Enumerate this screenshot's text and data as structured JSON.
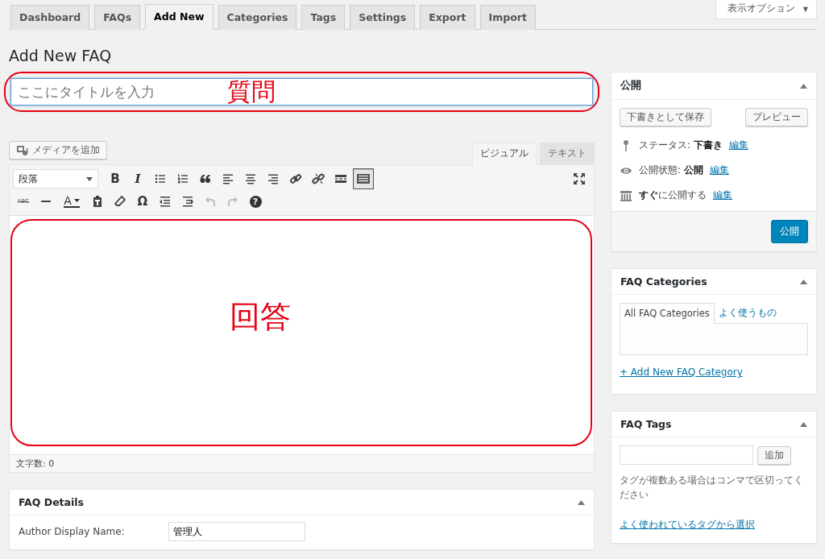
{
  "tabs": [
    {
      "label": "Dashboard",
      "selected": false
    },
    {
      "label": "FAQs",
      "selected": false
    },
    {
      "label": "Add New",
      "selected": true
    },
    {
      "label": "Categories",
      "selected": false
    },
    {
      "label": "Tags",
      "selected": false
    },
    {
      "label": "Settings",
      "selected": false
    },
    {
      "label": "Export",
      "selected": false
    },
    {
      "label": "Import",
      "selected": false
    }
  ],
  "screen_options": {
    "label": "表示オプション",
    "caret": "▼"
  },
  "heading": "Add New FAQ",
  "title_field": {
    "placeholder": "ここにタイトルを入力"
  },
  "annotations": [
    {
      "text": "質問"
    },
    {
      "text": "回答"
    }
  ],
  "editor": {
    "media_button": "メディアを追加",
    "mode_tabs": [
      {
        "label": "ビジュアル",
        "selected": true
      },
      {
        "label": "テキスト",
        "selected": false
      }
    ],
    "format_select": "段落",
    "toolbar_rows": [
      [
        {
          "kind": "bold",
          "glyph": "B"
        },
        {
          "kind": "italic",
          "glyph": "I"
        },
        {
          "kind": "bullets"
        },
        {
          "kind": "numbers"
        },
        {
          "kind": "quote"
        },
        {
          "kind": "align-left"
        },
        {
          "kind": "align-center"
        },
        {
          "kind": "align-right"
        },
        {
          "kind": "link"
        },
        {
          "kind": "unlink"
        },
        {
          "kind": "more"
        },
        {
          "kind": "kitchen-sink",
          "pressed": true
        }
      ],
      [
        {
          "kind": "strike",
          "glyph": "ABC"
        },
        {
          "kind": "hr"
        },
        {
          "kind": "color",
          "glyph": "A"
        },
        {
          "kind": "paste"
        },
        {
          "kind": "eraser"
        },
        {
          "kind": "symbol",
          "glyph": "Ω"
        },
        {
          "kind": "outdent"
        },
        {
          "kind": "indent"
        },
        {
          "kind": "undo",
          "disabled": true
        },
        {
          "kind": "redo",
          "disabled": true
        },
        {
          "kind": "help",
          "glyph": "?"
        }
      ]
    ],
    "word_count": "文字数: 0"
  },
  "details": {
    "title": "FAQ Details",
    "fields": [
      {
        "label": "Author Display Name:",
        "value": "管理人"
      }
    ]
  },
  "publish": {
    "title": "公開",
    "save_draft": "下書きとして保存",
    "preview": "プレビュー",
    "rows": [
      {
        "kind": "status",
        "label": "ステータス:",
        "value": "下書き",
        "link": "編集"
      },
      {
        "kind": "visibility",
        "label": "公開状態:",
        "value": "公開",
        "link": "編集"
      },
      {
        "kind": "schedule",
        "label": "に公開する",
        "value": "すぐ",
        "link": "編集"
      }
    ],
    "publish_button": "公開"
  },
  "categories": {
    "title": "FAQ Categories",
    "tabs": [
      {
        "label": "All FAQ Categories",
        "selected": true
      },
      {
        "label": "よく使うもの",
        "selected": false
      }
    ],
    "add_link": "+ Add New FAQ Category"
  },
  "tags": {
    "title": "FAQ Tags",
    "add_button": "追加",
    "hint": "タグが複数ある場合はコンマで区切ってください",
    "choose_link": "よく使われているタグから選択"
  }
}
